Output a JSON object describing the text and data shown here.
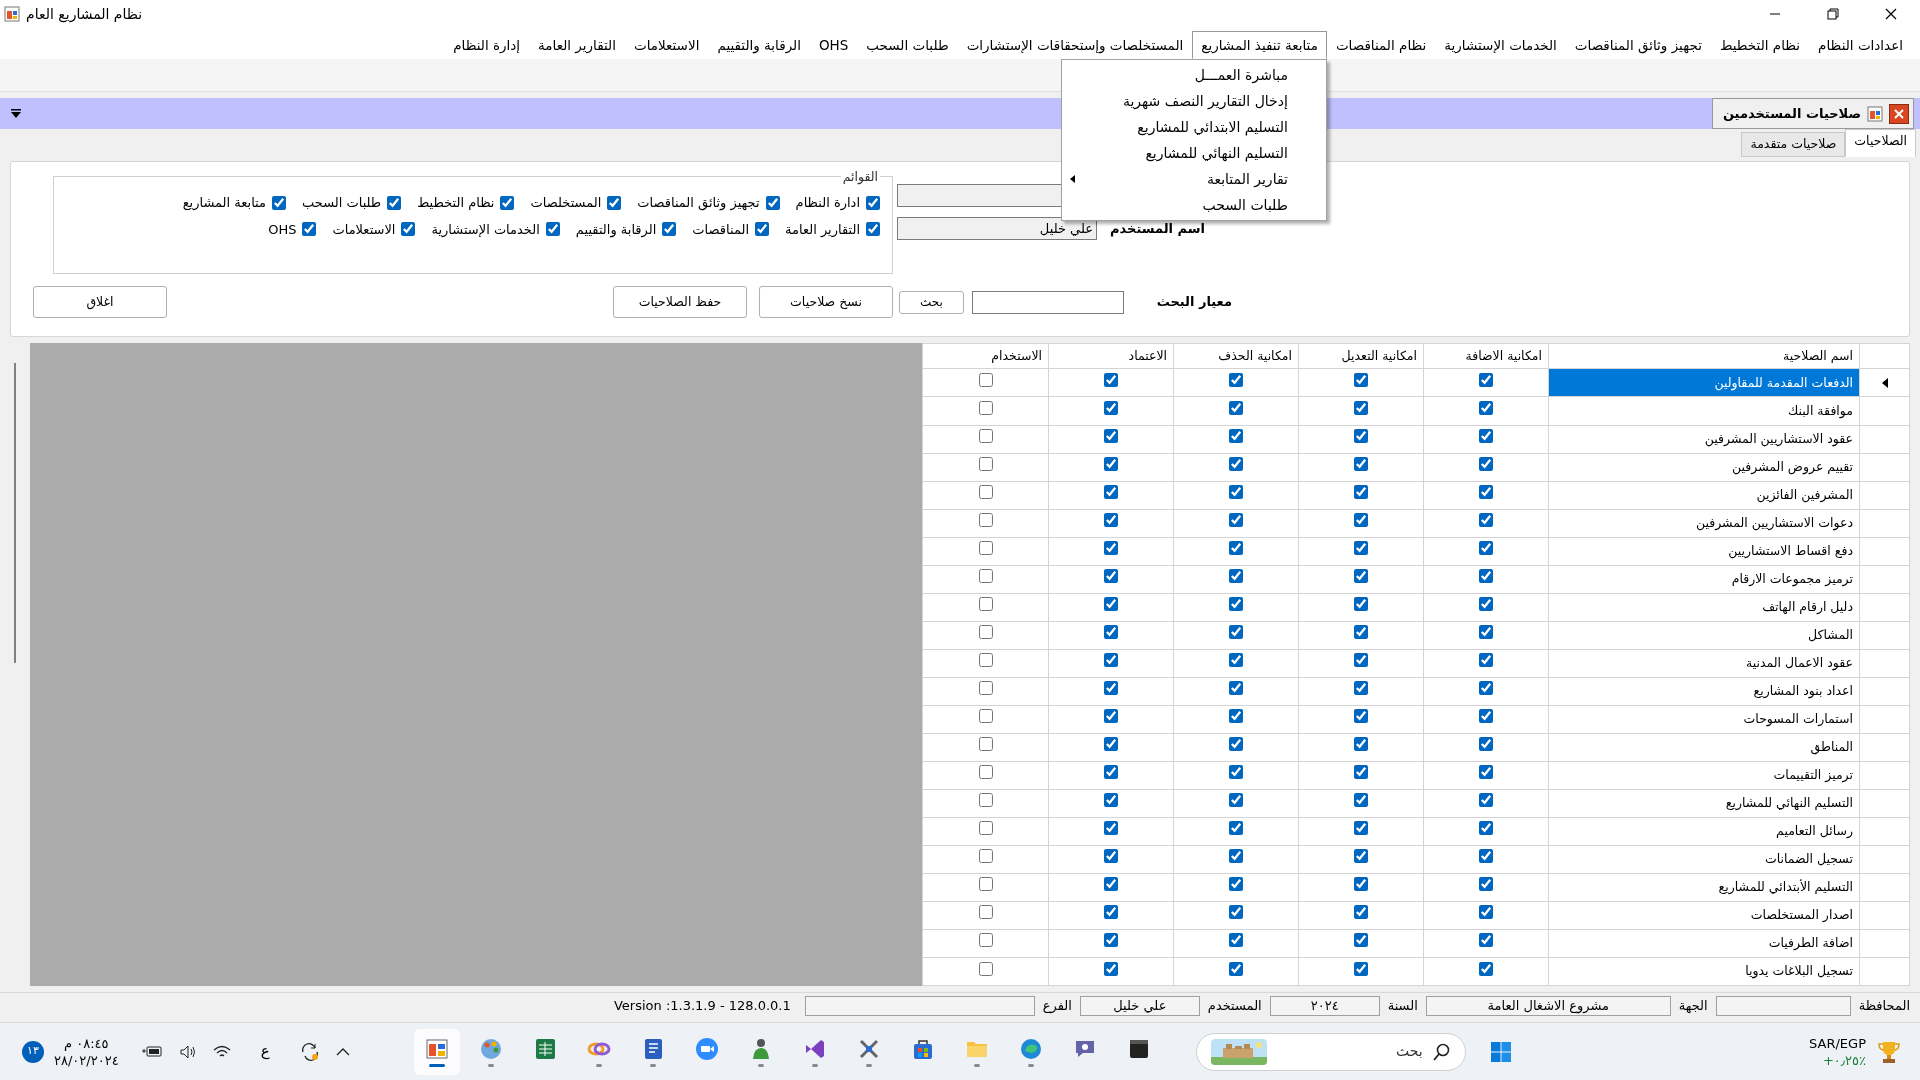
{
  "window": {
    "title": "نظام المشاريع العام"
  },
  "menu": [
    {
      "label": "اعدادات النظام",
      "selected": false
    },
    {
      "label": "نظام التخطيط",
      "selected": false
    },
    {
      "label": "تجهيز وثائق المناقصات",
      "selected": false
    },
    {
      "label": "الخدمات الإستشارية",
      "selected": false
    },
    {
      "label": "نظام المناقصات",
      "selected": false
    },
    {
      "label": "متابعة تنفيذ المشاريع",
      "selected": true
    },
    {
      "label": "المستخلصات وإستحقاقات الإستشارات",
      "selected": false
    },
    {
      "label": "طلبات السحب",
      "selected": false
    },
    {
      "label": "OHS",
      "selected": false
    },
    {
      "label": "الرقابة والتقييم",
      "selected": false
    },
    {
      "label": "الاستعلامات",
      "selected": false
    },
    {
      "label": "التقارير العامة",
      "selected": false
    },
    {
      "label": "إدارة النظام",
      "selected": false
    }
  ],
  "open_menu": {
    "items": [
      {
        "label": "مباشرة العمـــل",
        "has_submenu": false
      },
      {
        "label": "إدخال التقارير النصف شهرية",
        "has_submenu": false
      },
      {
        "label": "التسليم الابتدائي للمشاريع",
        "has_submenu": false
      },
      {
        "label": "التسليم النهائي للمشاريع",
        "has_submenu": false
      },
      {
        "label": "تقارير المتابعة",
        "has_submenu": true
      },
      {
        "label": "طلبات السحب",
        "has_submenu": false
      }
    ]
  },
  "document_tab": {
    "title": "صلاحيات المستخدمين"
  },
  "tabs": [
    {
      "label": "الصلاحيات",
      "selected": true
    },
    {
      "label": "صلاحيات متقدمة",
      "selected": false
    }
  ],
  "fields": [
    {
      "disabled": true
    },
    {
      "label": "اسم المستخدم",
      "value": "علي خليل",
      "disabled": true
    }
  ],
  "search": {
    "label": "معيار البحث",
    "button": "بحث"
  },
  "lists_group": {
    "title": "القوائم",
    "rows": [
      [
        {
          "label": "ادارة النظام",
          "checked": true
        },
        {
          "label": "تجهيز وثائق المناقصات",
          "checked": true
        },
        {
          "label": "المستخلصات",
          "checked": true
        },
        {
          "label": "نظام التخطيط",
          "checked": true
        },
        {
          "label": "طلبات السحب",
          "checked": true
        },
        {
          "label": "متابعة المشاريع",
          "checked": true
        }
      ],
      [
        {
          "label": "التقارير العامة",
          "checked": true
        },
        {
          "label": "المناقصات",
          "checked": true
        },
        {
          "label": "الرقابة والتقييم",
          "checked": true
        },
        {
          "label": "الخدمات الإستشارية",
          "checked": true
        },
        {
          "label": "الاستعلامات",
          "checked": true
        },
        {
          "label": "OHS",
          "checked": true
        }
      ]
    ]
  },
  "buttons": [
    "نسخ صلاحيات",
    "حفظ الصلاحيات",
    "اغلاق"
  ],
  "permissions_table": {
    "columns": [
      "اسم الصلاحية",
      "امكانية الاضافة",
      "امكانية التعديل",
      "امكانية الحذف",
      "الاعتماد",
      "الاستخدام"
    ],
    "rows": [
      {
        "name": "الدفعات المقدمة للمقاولين",
        "add": true,
        "edit": true,
        "delete": true,
        "approve": true,
        "use": false,
        "selected": true
      },
      {
        "name": "موافقة البنك",
        "add": true,
        "edit": true,
        "delete": true,
        "approve": true,
        "use": false,
        "selected": false
      },
      {
        "name": "عقود الاستشاريين المشرفين",
        "add": true,
        "edit": true,
        "delete": true,
        "approve": true,
        "use": false,
        "selected": false
      },
      {
        "name": "تقييم عروض المشرفين",
        "add": true,
        "edit": true,
        "delete": true,
        "approve": true,
        "use": false,
        "selected": false
      },
      {
        "name": "المشرفين الفائزين",
        "add": true,
        "edit": true,
        "delete": true,
        "approve": true,
        "use": false,
        "selected": false
      },
      {
        "name": "دعوات الاستشاريين المشرفين",
        "add": true,
        "edit": true,
        "delete": true,
        "approve": true,
        "use": false,
        "selected": false
      },
      {
        "name": "دفع اقساط الاستشاريين",
        "add": true,
        "edit": true,
        "delete": true,
        "approve": true,
        "use": false,
        "selected": false
      },
      {
        "name": "ترميز مجموعات الارقام",
        "add": true,
        "edit": true,
        "delete": true,
        "approve": true,
        "use": false,
        "selected": false
      },
      {
        "name": "دليل  ارقام الهاتف",
        "add": true,
        "edit": true,
        "delete": true,
        "approve": true,
        "use": false,
        "selected": false
      },
      {
        "name": "المشاكل",
        "add": true,
        "edit": true,
        "delete": true,
        "approve": true,
        "use": false,
        "selected": false
      },
      {
        "name": "عقود الاعمال المدنية",
        "add": true,
        "edit": true,
        "delete": true,
        "approve": true,
        "use": false,
        "selected": false
      },
      {
        "name": "اعداد بنود المشاريع",
        "add": true,
        "edit": true,
        "delete": true,
        "approve": true,
        "use": false,
        "selected": false
      },
      {
        "name": "استمارات المسوحات",
        "add": true,
        "edit": true,
        "delete": true,
        "approve": true,
        "use": false,
        "selected": false
      },
      {
        "name": "المناطق",
        "add": true,
        "edit": true,
        "delete": true,
        "approve": true,
        "use": false,
        "selected": false
      },
      {
        "name": "ترميز التقييمات",
        "add": true,
        "edit": true,
        "delete": true,
        "approve": true,
        "use": false,
        "selected": false
      },
      {
        "name": "التسليم النهائي للمشاريع",
        "add": true,
        "edit": true,
        "delete": true,
        "approve": true,
        "use": false,
        "selected": false
      },
      {
        "name": "رسائل التعاميم",
        "add": true,
        "edit": true,
        "delete": true,
        "approve": true,
        "use": false,
        "selected": false
      },
      {
        "name": "تسجيل الضمانات",
        "add": true,
        "edit": true,
        "delete": true,
        "approve": true,
        "use": false,
        "selected": false
      },
      {
        "name": "التسليم الأبتدائي للمشاريع",
        "add": true,
        "edit": true,
        "delete": true,
        "approve": true,
        "use": false,
        "selected": false
      },
      {
        "name": "اصدار المستخلصات",
        "add": true,
        "edit": true,
        "delete": true,
        "approve": true,
        "use": false,
        "selected": false
      },
      {
        "name": "اضافة الطرفيات",
        "add": true,
        "edit": true,
        "delete": true,
        "approve": true,
        "use": false,
        "selected": false
      },
      {
        "name": "تسجيل البلاغات يدويا",
        "add": true,
        "edit": true,
        "delete": true,
        "approve": true,
        "use": false,
        "selected": false
      }
    ]
  },
  "status_bar": {
    "fields": [
      {
        "label": "المحافظة"
      },
      {
        "label": "الجهة",
        "value": "مشروع الاشغال العامة"
      },
      {
        "label": "السنة",
        "value": "٢٠٢٤"
      },
      {
        "label": "المستخدم",
        "value": "علي خليل"
      },
      {
        "label": "الفرع"
      }
    ],
    "version": "Version :1.3.1.9 - 128.0.0.1"
  },
  "taskbar": {
    "notifications": "١٣",
    "time": "٠٨:٤٥ م",
    "date": "٢٨/٠٢/٢٠٢٤",
    "input_language": "ع",
    "apps": [
      {
        "kind": "window",
        "selected": true,
        "running": true
      },
      {
        "kind": "palette",
        "selected": false,
        "running": true
      },
      {
        "kind": "spreadsheet",
        "selected": false,
        "running": false
      },
      {
        "kind": "rings",
        "selected": false,
        "running": true
      },
      {
        "kind": "document",
        "selected": false,
        "running": true
      },
      {
        "kind": "video",
        "selected": false,
        "running": false
      },
      {
        "kind": "person",
        "selected": false,
        "running": true
      },
      {
        "kind": "ribbon",
        "selected": false,
        "running": true
      },
      {
        "kind": "tools",
        "selected": false,
        "running": true
      },
      {
        "kind": "bag",
        "selected": false,
        "running": false
      },
      {
        "kind": "folder",
        "selected": false,
        "running": true
      },
      {
        "kind": "swirl",
        "selected": false,
        "running": true
      },
      {
        "kind": "chat",
        "selected": false,
        "running": false
      },
      {
        "kind": "terminal",
        "selected": false,
        "running": false
      }
    ],
    "search_placeholder": "بحث",
    "ticker": {
      "symbol": "SAR/EGP",
      "change": "+٠٫٢٥٪"
    }
  }
}
